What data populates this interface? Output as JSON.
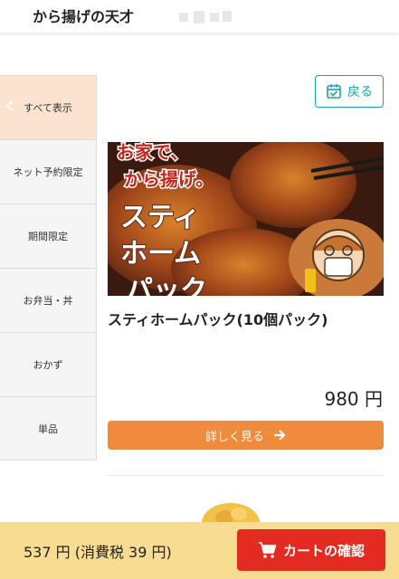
{
  "header": {
    "title": "から揚げの天才"
  },
  "sidebar": {
    "items": [
      {
        "label": "すべて表示"
      },
      {
        "label": "ネット予約限定"
      },
      {
        "label": "期間限定"
      },
      {
        "label": "お弁当・丼"
      },
      {
        "label": "おかず"
      },
      {
        "label": "単品"
      }
    ]
  },
  "back_button": {
    "label": "戻る",
    "icon": "calendar-check-icon"
  },
  "product": {
    "image_text": [
      "お家で、",
      "から揚げ。",
      "スティ",
      "ホーム",
      "パック"
    ],
    "name": "スティホームパック(10個パック)",
    "price": "980 円",
    "detail_label": "詳しく見る",
    "detail_icon": "arrow-right-icon"
  },
  "cart": {
    "total": "537 円 (消費税 39 円)",
    "button_label": "カートの確認",
    "button_icon": "cart-icon"
  },
  "colors": {
    "accent_teal": "#1aa3ad",
    "detail_orange": "#f08a3c",
    "cart_red": "#e32b21",
    "cart_bar_bg": "#f8dc92",
    "active_item_bg": "#fbe3cf"
  }
}
